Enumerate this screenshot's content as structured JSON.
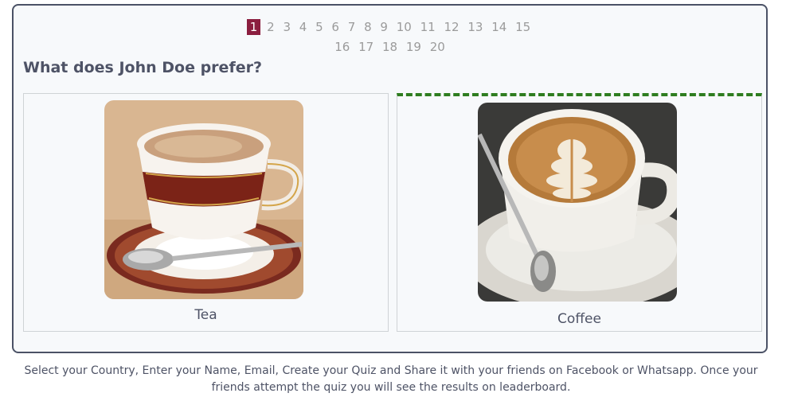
{
  "pager": {
    "row1": [
      "1",
      "2",
      "3",
      "4",
      "5",
      "6",
      "7",
      "8",
      "9",
      "10",
      "11",
      "12",
      "13",
      "14",
      "15"
    ],
    "row2": [
      "16",
      "17",
      "18",
      "19",
      "20"
    ],
    "active": "1",
    "active_color": "#8b1e3f"
  },
  "question": "What does John Doe prefer?",
  "options": [
    {
      "label": "Tea",
      "image": "tea-cup-image",
      "selected": false
    },
    {
      "label": "Coffee",
      "image": "latte-art-coffee-image",
      "selected": true
    }
  ],
  "selected_border_color": "#2e7d1f",
  "footer": "Select your Country, Enter your Name, Email, Create your Quiz and Share it with your friends on Facebook or Whatsapp. Once your friends attempt the quiz you will see the results on leaderboard."
}
